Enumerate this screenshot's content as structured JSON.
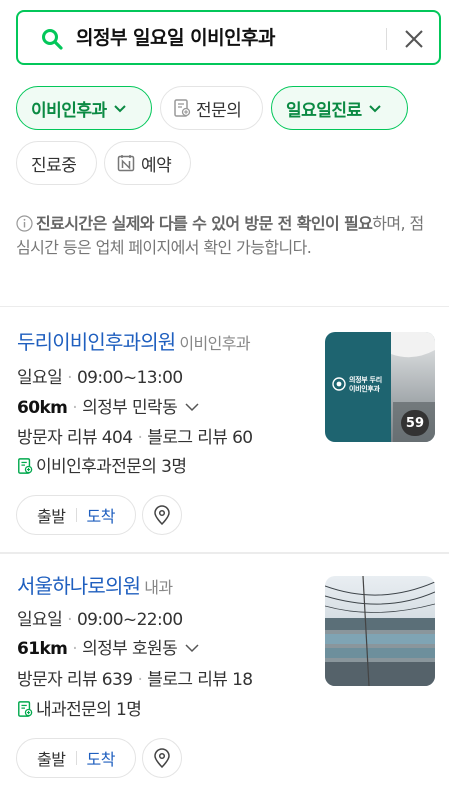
{
  "search": {
    "query": "의정부 일요일 이비인후과"
  },
  "filters": {
    "chips": [
      {
        "label": "이비인후과"
      },
      {
        "label": "전문의"
      },
      {
        "label": "일요일진료"
      },
      {
        "label": "진료중"
      },
      {
        "label": "예약"
      }
    ]
  },
  "notice": {
    "bold_text": "진료시간은 실제와 다를 수 있어 방문 전 확인이 필요",
    "text": "하며, 점심시간 등은 업체 페이지에서 확인 가능합니다."
  },
  "places": [
    {
      "name": "두리이비인후과의원",
      "category": "이비인후과",
      "day": "일요일",
      "hours": "09:00~13:00",
      "distance": "60km",
      "address": "의정부 민락동",
      "visitor_review": "방문자 리뷰 404",
      "blog_review": "블로그 리뷰 60",
      "specialist": "이비인후과전문의 3명",
      "photo_count": "59",
      "thumb_sign": "의정부 두리\n이비인후과",
      "start_label": "출발",
      "arrive_label": "도착"
    },
    {
      "name": "서울하나로의원",
      "category": "내과",
      "day": "일요일",
      "hours": "09:00~22:00",
      "distance": "61km",
      "address": "의정부 호원동",
      "visitor_review": "방문자 리뷰 639",
      "blog_review": "블로그 리뷰 18",
      "specialist": "내과전문의 1명",
      "start_label": "출발",
      "arrive_label": "도착"
    }
  ],
  "colors": {
    "accent": "#03c75a",
    "link": "#1f5fbf"
  }
}
